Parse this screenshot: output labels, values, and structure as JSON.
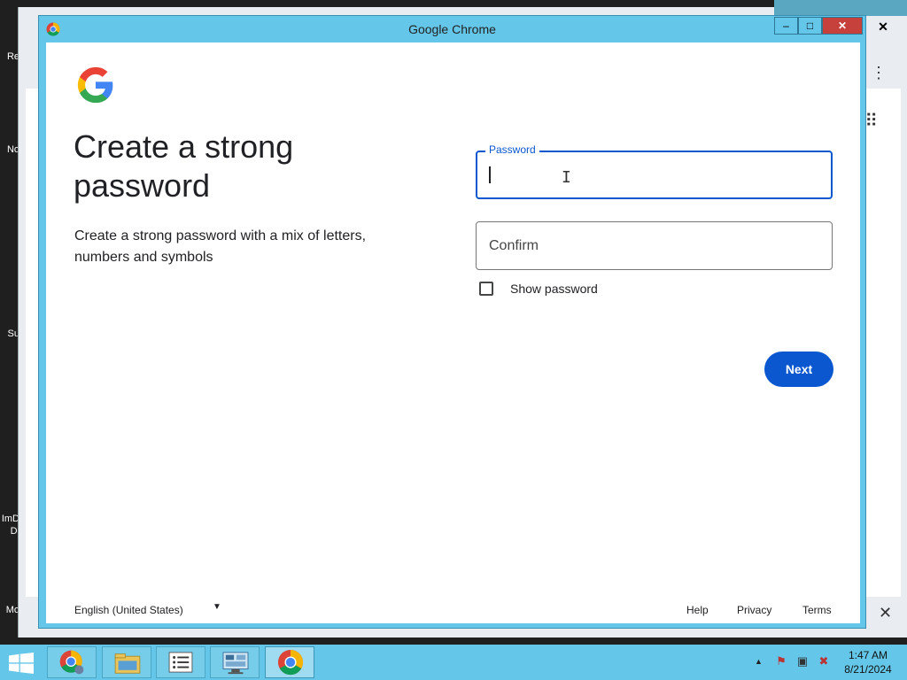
{
  "desktop": {
    "icons": [
      {
        "label": "Re"
      },
      {
        "label": "No"
      },
      {
        "label": "Su"
      },
      {
        "label": "ImD"
      },
      {
        "label": "Di"
      },
      {
        "label": "Mo"
      }
    ]
  },
  "window": {
    "title": "Google Chrome",
    "min_label": "‒",
    "max_label": "□",
    "close_label": "✕"
  },
  "page": {
    "headline": "Create a strong password",
    "subtext": "Create a strong password with a mix of letters, numbers and symbols",
    "password": {
      "label": "Password",
      "value": ""
    },
    "confirm": {
      "placeholder": "Confirm",
      "value": ""
    },
    "show_password": {
      "label": "Show password",
      "checked": false
    },
    "next_label": "Next"
  },
  "footer": {
    "language": "English (United States)",
    "links": {
      "help": "Help",
      "privacy": "Privacy",
      "terms": "Terms"
    }
  },
  "taskbar": {
    "clock_time": "1:47 AM",
    "clock_date": "8/21/2024",
    "items": [
      {
        "icon": "chrome-user-icon"
      },
      {
        "icon": "file-explorer-icon"
      },
      {
        "icon": "task-list-icon"
      },
      {
        "icon": "control-panel-icon"
      },
      {
        "icon": "chrome-icon",
        "active": true
      }
    ]
  },
  "colors": {
    "accent_blue": "#0b57d0",
    "window_frame": "#64c6e8",
    "close_red": "#c7413c"
  }
}
